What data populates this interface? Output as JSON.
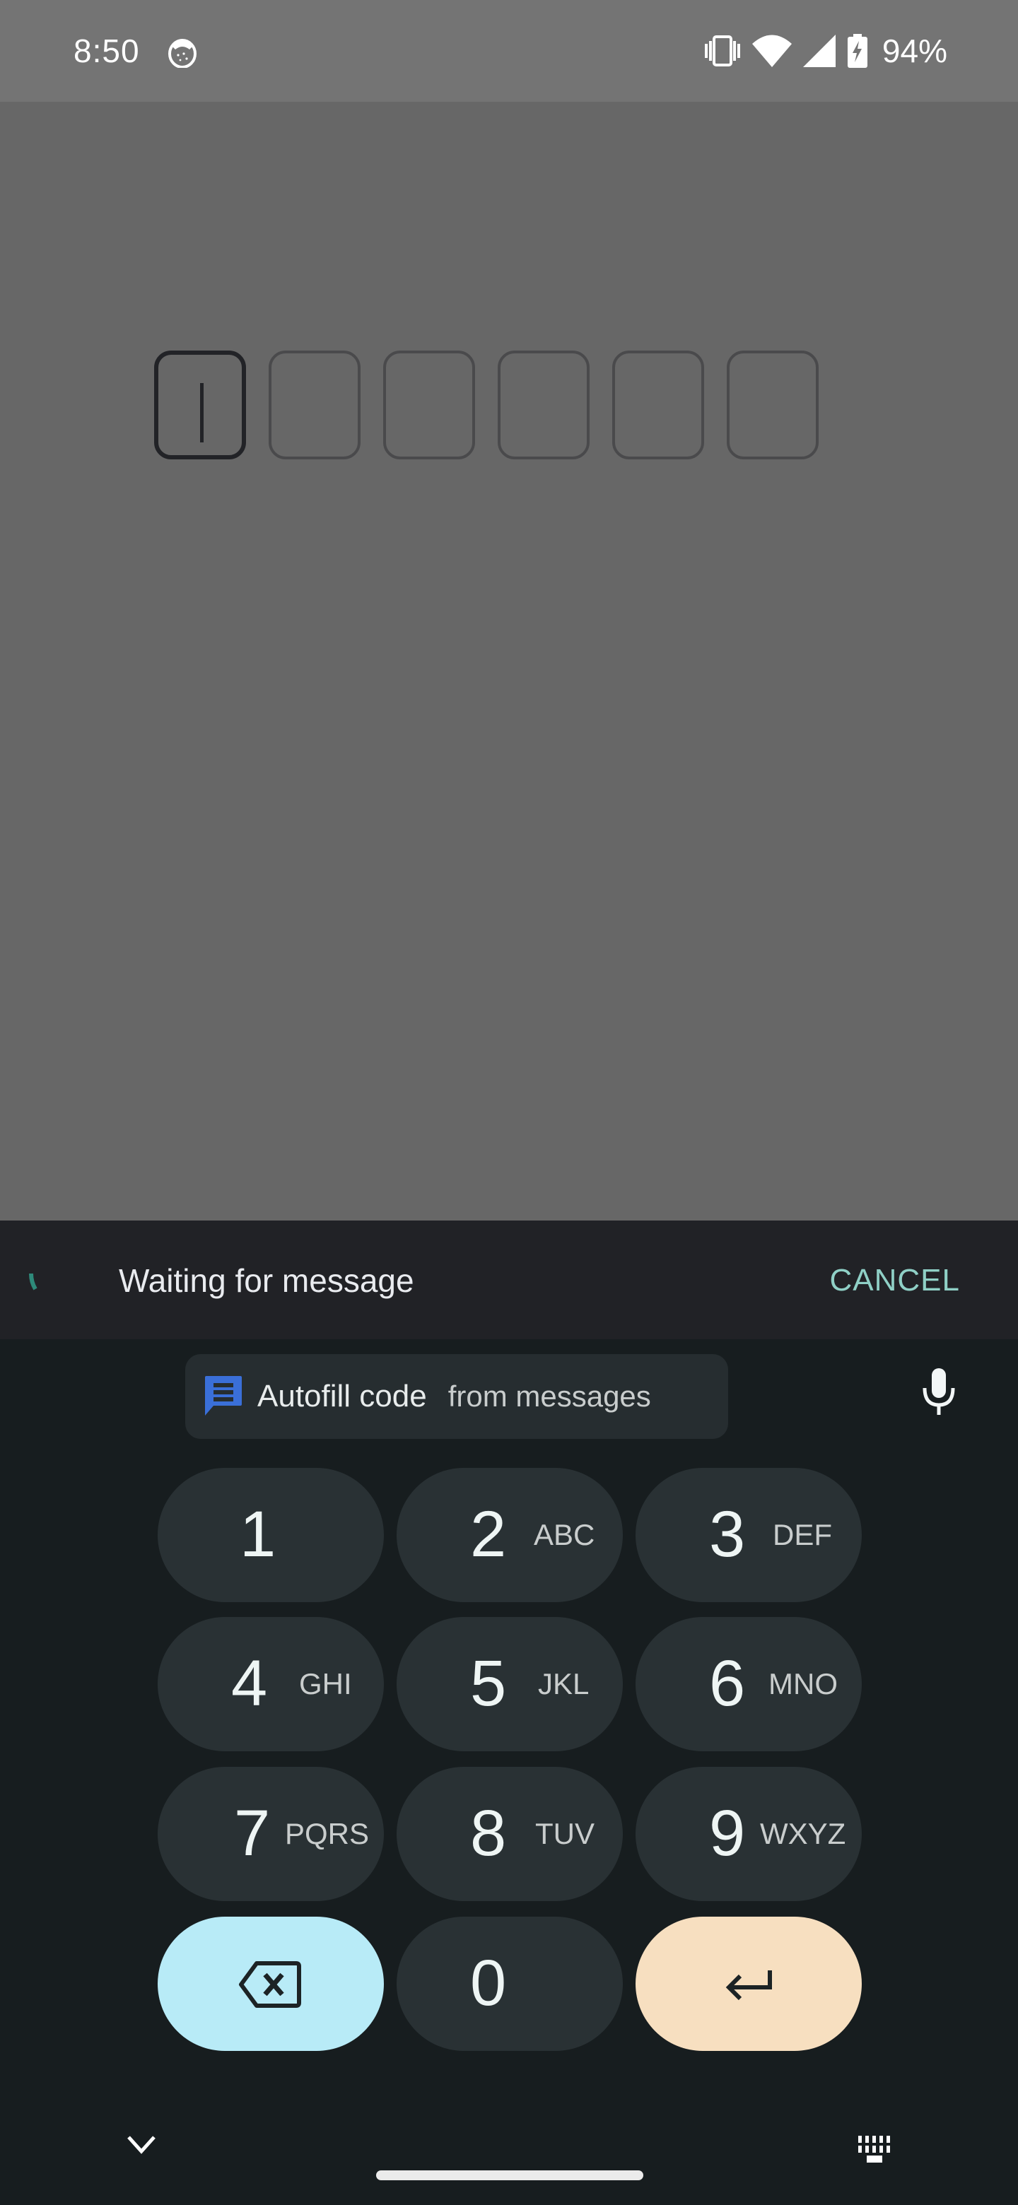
{
  "status_bar": {
    "time": "8:50",
    "app_icon": "cookie-jar-icon",
    "icons": [
      "vibrate-icon",
      "wifi-icon",
      "cell-signal-icon",
      "battery-charging-icon"
    ],
    "battery_percent": "94%"
  },
  "otp": {
    "digit_count": 6,
    "values": [
      "",
      "",
      "",
      "",
      "",
      ""
    ],
    "active_index": 0
  },
  "sms_retriever": {
    "status_text": "Waiting for message",
    "cancel_label": "CANCEL",
    "accent_color": "#8fd0c6"
  },
  "keyboard": {
    "suggestion": {
      "icon": "message-icon",
      "main_label": "Autofill code",
      "sub_label": "from messages"
    },
    "mic_icon": "microphone-icon",
    "keys": [
      {
        "num": "1",
        "letters": ""
      },
      {
        "num": "2",
        "letters": "ABC"
      },
      {
        "num": "3",
        "letters": "DEF"
      },
      {
        "num": "4",
        "letters": "GHI"
      },
      {
        "num": "5",
        "letters": "JKL"
      },
      {
        "num": "6",
        "letters": "MNO"
      },
      {
        "num": "7",
        "letters": "PQRS"
      },
      {
        "num": "8",
        "letters": "TUV"
      },
      {
        "num": "9",
        "letters": "WXYZ"
      },
      {
        "num": "0",
        "letters": ""
      }
    ],
    "backspace_icon": "backspace-icon",
    "enter_icon": "enter-icon",
    "colors": {
      "backspace": "#b8ebf7",
      "enter": "#f7dfc0",
      "key": "#293134"
    }
  },
  "nav": {
    "hide_keyboard_icon": "chevron-down-icon",
    "switch_keyboard_icon": "keyboard-icon"
  }
}
